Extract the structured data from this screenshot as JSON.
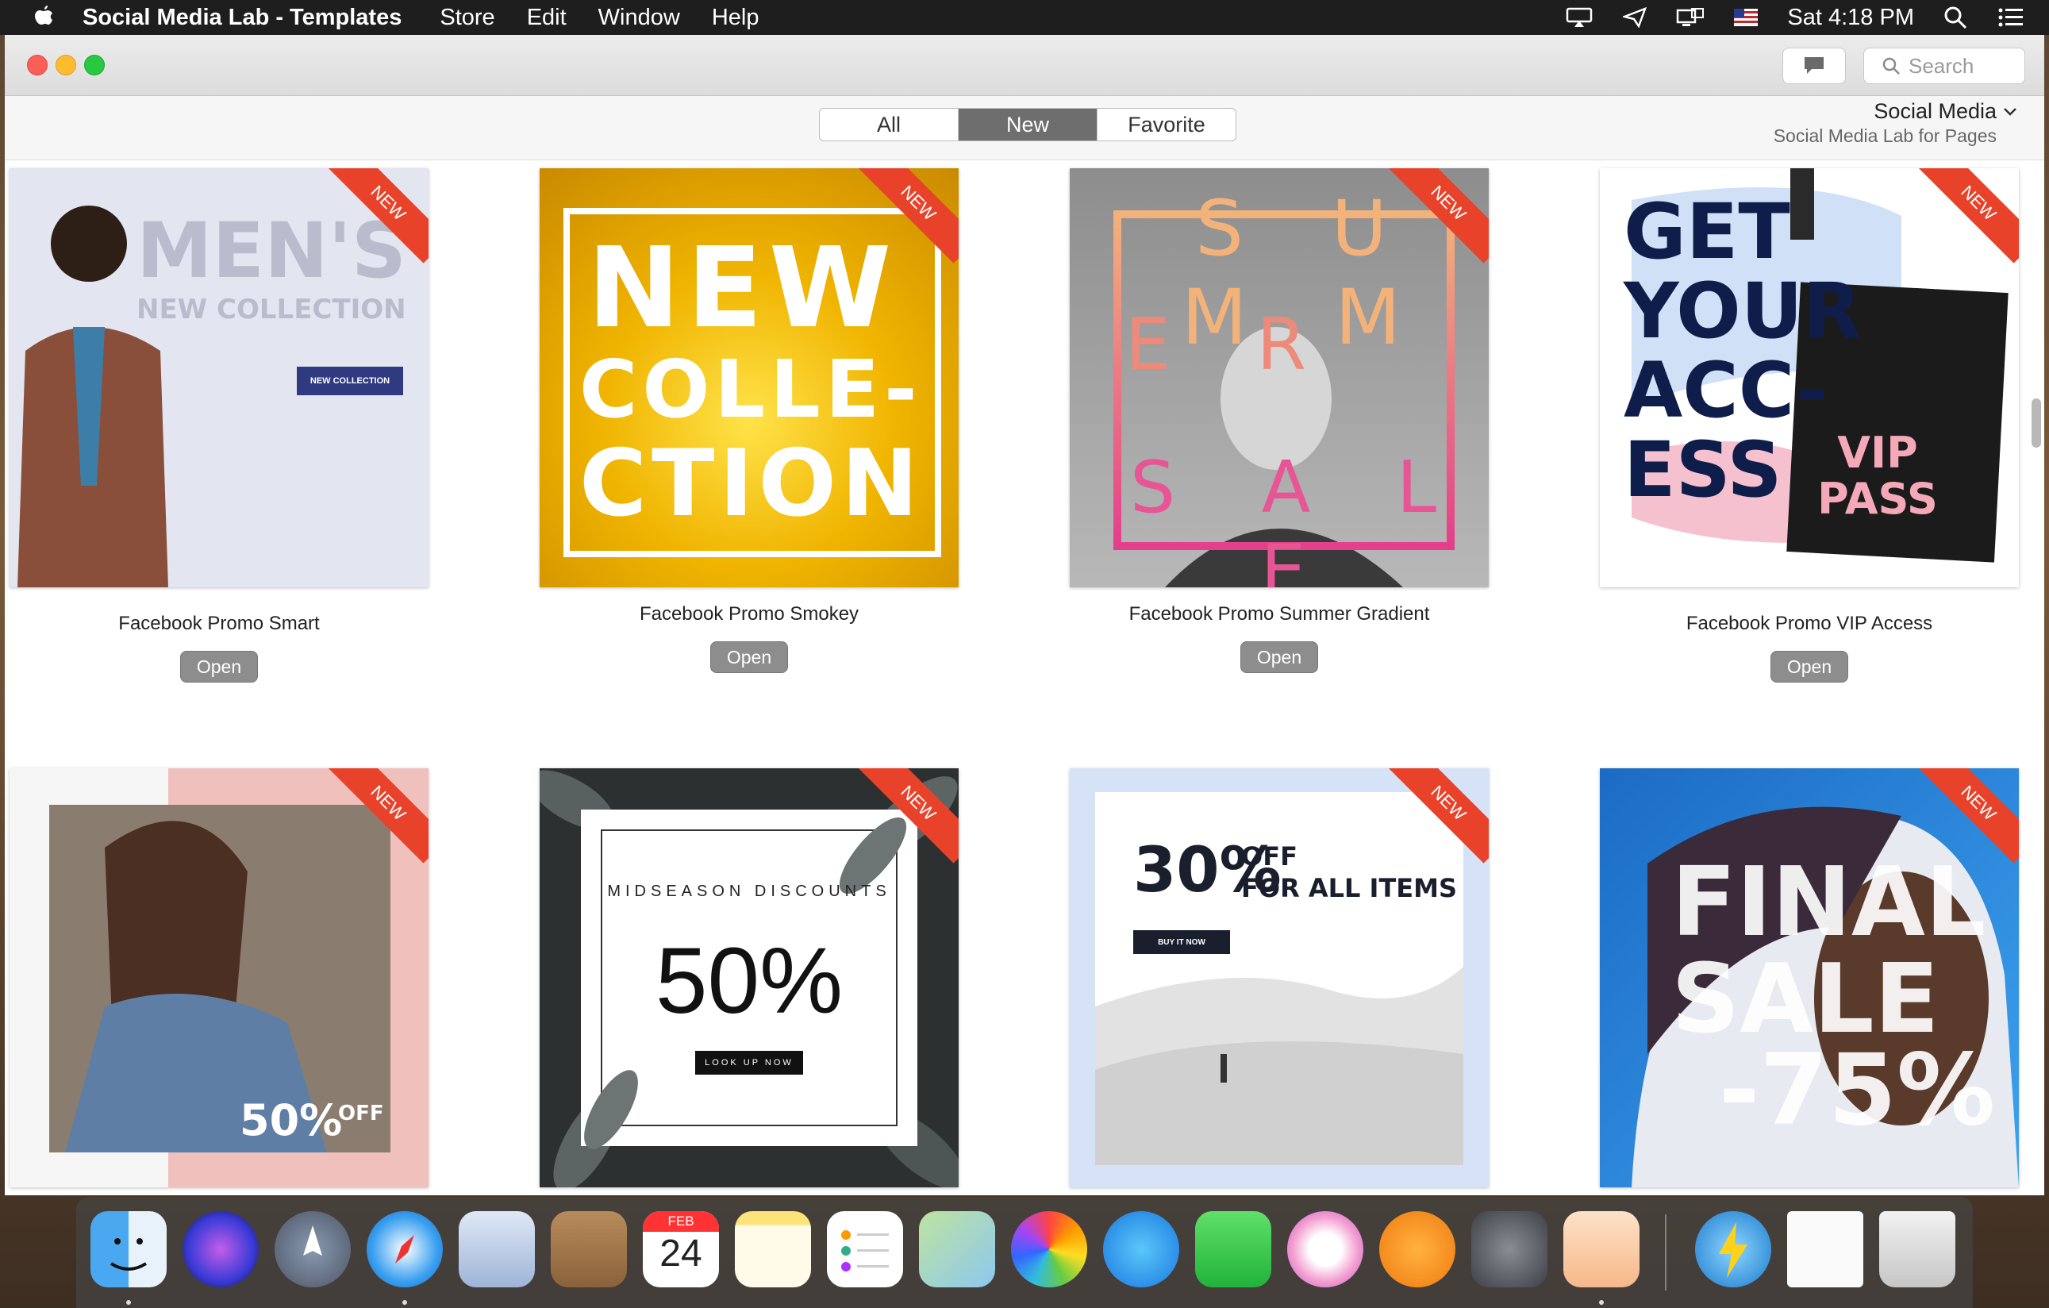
{
  "menubar": {
    "app_name": "Social Media Lab - Templates",
    "items": [
      "Store",
      "Edit",
      "Window",
      "Help"
    ],
    "clock": "Sat 4:18 PM"
  },
  "window": {
    "search_placeholder": "Search",
    "filters": [
      "All",
      "New",
      "Favorite"
    ],
    "active_filter": "New",
    "category": {
      "title": "Social Media",
      "subtitle": "Social Media Lab for Pages"
    }
  },
  "badge_label": "NEW",
  "open_label": "Open",
  "templates": [
    {
      "title": "Facebook Promo Smart",
      "art": {
        "line1": "MEN'S",
        "line2": "NEW COLLECTION",
        "button": "NEW COLLECTION"
      }
    },
    {
      "title": "Facebook Promo Smokey",
      "art": {
        "line1": "NEW",
        "line2": "COLLE-",
        "line3": "CTION"
      }
    },
    {
      "title": "Facebook Promo Summer Gradient",
      "art": {
        "line1": "S U M M",
        "line2": "E R",
        "line3": "S A L E"
      }
    },
    {
      "title": "Facebook Promo VIP Access",
      "art": {
        "line1": "GET",
        "line2": "YOUR",
        "line3": "ACC-",
        "line4": "ESS",
        "pass": "VIP PASS"
      }
    },
    {
      "title": "",
      "art": {
        "line1": "50%",
        "line2": "OFF"
      }
    },
    {
      "title": "",
      "art": {
        "line1": "MIDSEASON DISCOUNTS",
        "line2": "50%",
        "button": "LOOK UP NOW"
      }
    },
    {
      "title": "",
      "art": {
        "line1": "30%",
        "line2": "OFF",
        "line3": "FOR ALL ITEMS",
        "button": "BUY IT NOW"
      }
    },
    {
      "title": "",
      "art": {
        "line1": "FINAL",
        "line2": "SALE",
        "line3": "-75%"
      }
    }
  ],
  "dock": {
    "apps": [
      "finder-icon",
      "siri-icon",
      "launchpad-icon",
      "safari-icon",
      "mail-icon",
      "contacts-icon",
      "calendar-icon",
      "notes-icon",
      "reminders-icon",
      "maps-icon",
      "photos-icon",
      "messages-icon",
      "facetime-icon",
      "itunes-icon",
      "ibooks-icon",
      "system-preferences-icon",
      "social-media-lab-icon",
      "network-radar-icon",
      "document-icon",
      "trash-icon"
    ],
    "calendar_month": "FEB",
    "calendar_day": "24"
  },
  "colors": {
    "ribbon": "#e8432a",
    "button_gray": "#8d8d8d",
    "active_segment": "#6e6e6e"
  }
}
